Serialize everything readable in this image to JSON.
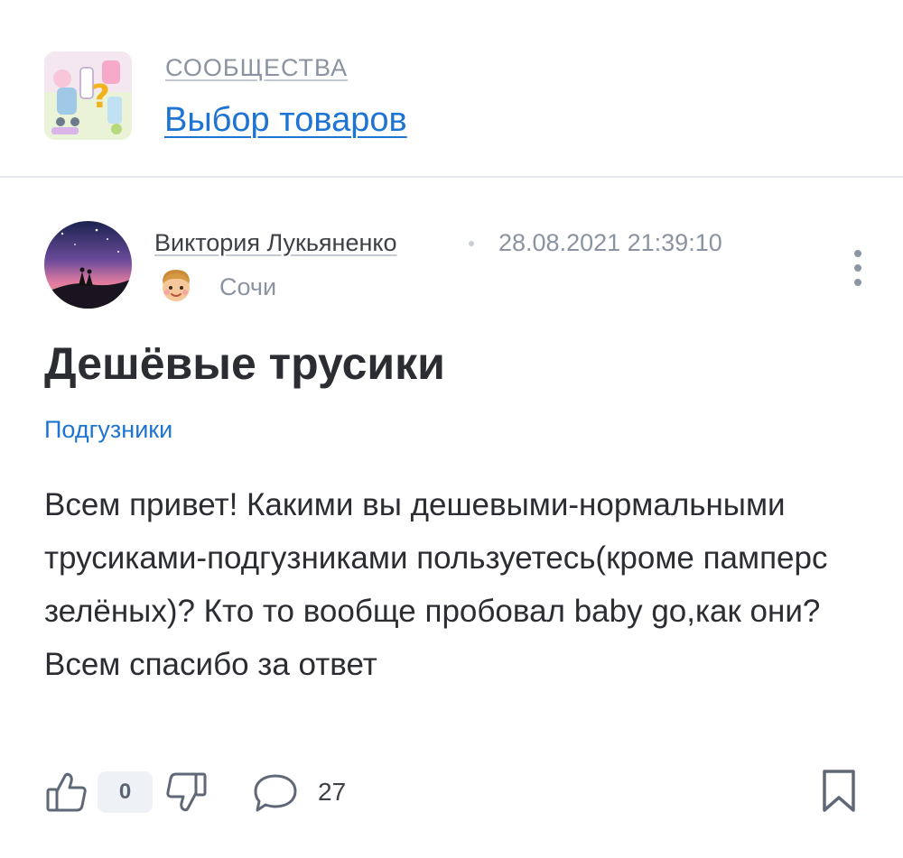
{
  "community": {
    "kicker": "СООБЩЕСТВА",
    "name": "Выбор товаров"
  },
  "post": {
    "author": "Виктория Лукьяненко",
    "date": "28.08.2021 21:39:10",
    "city": "Сочи",
    "title": "Дешёвые трусики",
    "tag": "Подгузники",
    "body": "Всем привет! Какими вы дешевыми-нормальными трусиками-подгузниками пользуетесь(кроме памперс зелёных)? Кто то вообще пробовал baby go,как они? Всем спасибо за ответ"
  },
  "actions": {
    "like_count": "0",
    "comment_count": "27"
  },
  "icons": {
    "like": "thumb-up-icon",
    "dislike": "thumb-down-icon",
    "comments": "speech-bubble-icon",
    "bookmark": "bookmark-icon",
    "more": "more-vertical-icon",
    "badge": "boy-face-icon"
  },
  "colors": {
    "link": "#1e74d2",
    "muted": "#8b93a1",
    "text": "#2b2d33",
    "icon": "#5f6877"
  }
}
